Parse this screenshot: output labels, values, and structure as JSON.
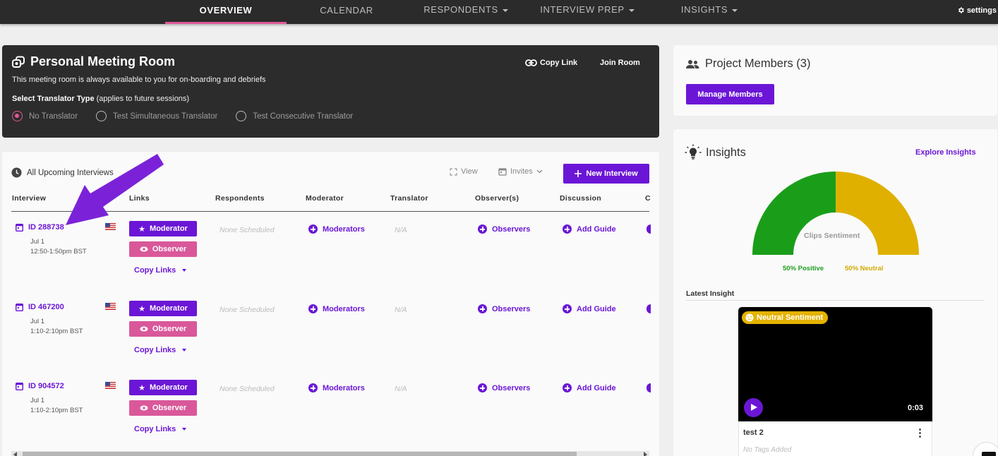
{
  "nav": {
    "items": [
      {
        "label": "OVERVIEW",
        "active": true,
        "dropdown": false
      },
      {
        "label": "CALENDAR",
        "active": false,
        "dropdown": false
      },
      {
        "label": "RESPONDENTS",
        "active": false,
        "dropdown": true
      },
      {
        "label": "INTERVIEW PREP",
        "active": false,
        "dropdown": true
      },
      {
        "label": "INSIGHTS",
        "active": false,
        "dropdown": true
      }
    ],
    "settings_label": "settings"
  },
  "meeting_room": {
    "title": "Personal Meeting Room",
    "subtitle": "This meeting room is always available to you for on-boarding and debriefs",
    "translator_label": "Select Translator Type",
    "translator_note": "(applies to future sessions)",
    "options": [
      "No Translator",
      "Test Simultaneous Translator",
      "Test Consecutive Translator"
    ],
    "selected_option": "No Translator",
    "copy_link": "Copy Link",
    "join_room": "Join Room"
  },
  "interviews": {
    "header": "All Upcoming Interviews",
    "view": "View",
    "invites": "Invites",
    "new_interview": "New Interview",
    "columns": [
      "Interview",
      "Links",
      "Respondents",
      "Moderator",
      "Translator",
      "Observer(s)",
      "Discussion",
      "C"
    ],
    "rows": [
      {
        "id": "ID 288738",
        "date": "Jul 1",
        "time": "12:50-1:50pm BST",
        "moderator_btn": "Moderator",
        "observer_btn": "Observer",
        "copy_links": "Copy Links",
        "respondents": "None Scheduled",
        "moderators": "Moderators",
        "translator": "N/A",
        "observers": "Observers",
        "discussion": "Add Guide"
      },
      {
        "id": "ID 467200",
        "date": "Jul 1",
        "time": "1:10-2:10pm BST",
        "moderator_btn": "Moderator",
        "observer_btn": "Observer",
        "copy_links": "Copy Links",
        "respondents": "None Scheduled",
        "moderators": "Moderators",
        "translator": "N/A",
        "observers": "Observers",
        "discussion": "Add Guide"
      },
      {
        "id": "ID 904572",
        "date": "Jul 1",
        "time": "1:10-2:10pm BST",
        "moderator_btn": "Moderator",
        "observer_btn": "Observer",
        "copy_links": "Copy Links",
        "respondents": "None Scheduled",
        "moderators": "Moderators",
        "translator": "N/A",
        "observers": "Observers",
        "discussion": "Add Guide"
      }
    ]
  },
  "members": {
    "title": "Project Members (3)",
    "manage": "Manage Members"
  },
  "insights": {
    "title": "Insights",
    "explore": "Explore Insights",
    "gauge_label": "Clips Sentiment",
    "positive": "50% Positive",
    "neutral": "50% Neutral",
    "positive_fraction": 0.5,
    "neutral_fraction": 0.5,
    "positive_color": "#1a9e1a",
    "neutral_color": "#dfb000",
    "latest_label": "Latest Insight",
    "clip": {
      "badge": "Neutral Sentiment",
      "duration": "0:03",
      "name": "test 2",
      "tags": "No Tags Added"
    }
  },
  "colors": {
    "accent": "#6b16d6",
    "pink": "#d9589a",
    "nav_bg": "#2b2b2b"
  }
}
